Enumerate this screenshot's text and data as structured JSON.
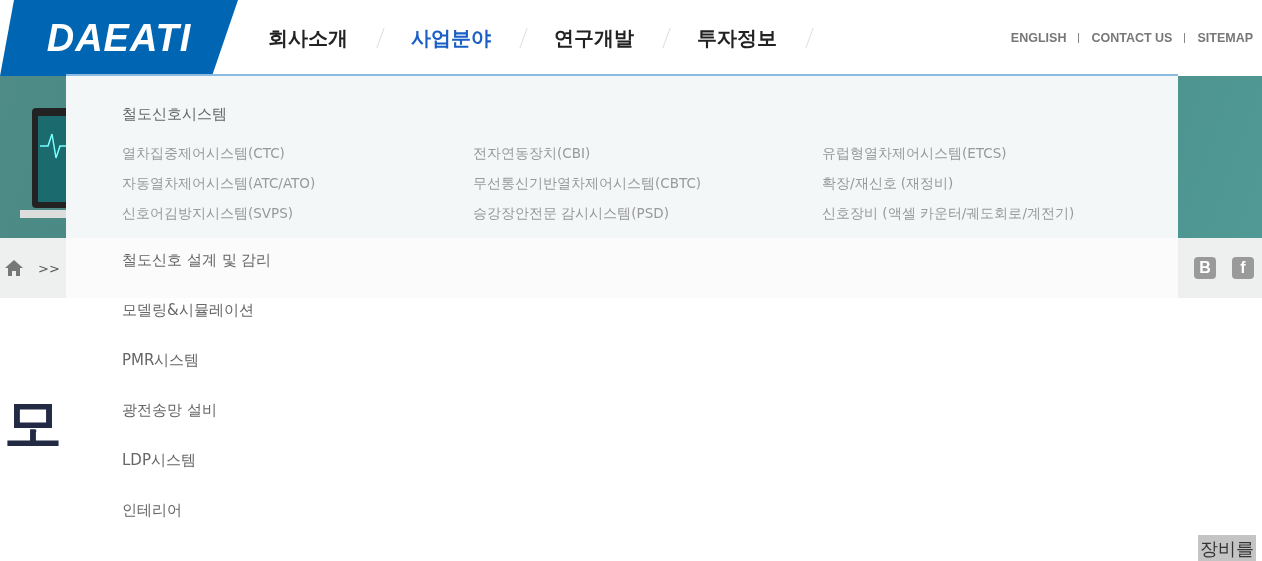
{
  "logo": {
    "text": "DAEATI"
  },
  "nav": [
    {
      "label": "회사소개",
      "selected": false
    },
    {
      "label": "사업분야",
      "selected": true
    },
    {
      "label": "연구개발",
      "selected": false
    },
    {
      "label": "투자정보",
      "selected": false
    }
  ],
  "util_links": [
    "ENGLISH",
    "CONTACT US",
    "SITEMAP"
  ],
  "breadcrumb": {
    "separator": ">>"
  },
  "social": [
    "B",
    "f"
  ],
  "page_title": "모",
  "paragraph_fragment": "장비를",
  "mega_menu": [
    {
      "label": "철도신호시스템",
      "children": [
        "열차집중제어시스템(CTC)",
        "전자연동장치(CBI)",
        "유럽형열차제어시스템(ETCS)",
        "자동열차제어시스템(ATC/ATO)",
        "무선통신기반열차제어시스템(CBTC)",
        "확장/재신호 (재정비)",
        "신호어김방지시스템(SVPS)",
        "승강장안전문 감시시스템(PSD)",
        "신호장비 (액셀 카운터/궤도회로/계전기)"
      ]
    },
    {
      "label": "철도신호 설계 및 감리"
    },
    {
      "label": "모델링&시뮬레이션"
    },
    {
      "label": "PMR시스템"
    },
    {
      "label": "광전송망 설비"
    },
    {
      "label": "LDP시스템"
    },
    {
      "label": "인테리어"
    }
  ]
}
